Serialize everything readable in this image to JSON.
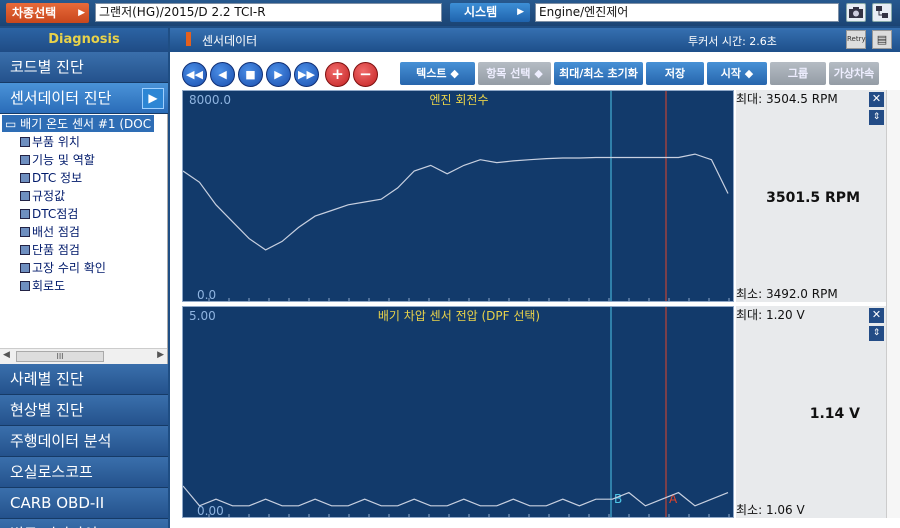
{
  "topbar": {
    "vehicle_btn": "차종선택",
    "vehicle_value": "그랜저(HG)/2015/D 2.2 TCI-R",
    "system_btn": "시스템",
    "system_value": "Engine/엔진제어"
  },
  "sidebar": {
    "header": "Diagnosis",
    "menu_top": [
      {
        "label": "코드별 진단"
      },
      {
        "label": "센서데이터 진단"
      }
    ],
    "tree_root": "배기 온도 센서 #1 (DOC",
    "tree_items": [
      "부품 위치",
      "기능 및 역할",
      "DTC 정보",
      "규정값",
      "DTC점검",
      "배선 점검",
      "단품 점검",
      "고장 수리 확인",
      "회로도"
    ],
    "scroll_thumb": "III",
    "menu_bottom": [
      {
        "label": "사례별 진단"
      },
      {
        "label": "현상별 진단"
      },
      {
        "label": "주행데이터 분석"
      },
      {
        "label": "오실로스코프"
      },
      {
        "label": "CARB OBD-II"
      },
      {
        "label": "법규 진단가이드"
      }
    ]
  },
  "main": {
    "title": "센서데이터",
    "cursor_time": "투커서 시간: 2.6초",
    "retry_label": "Retry",
    "toolbar": {
      "text_btn": "텍스트 ◆",
      "item_select": "항목 선택 ◆",
      "reset_minmax": "최대/최소 초기화",
      "save": "저장",
      "start": "시작 ◆",
      "group": "그룹",
      "virtual": "가상차속"
    }
  },
  "panels": [
    {
      "name": "엔진 회전수",
      "ymax": "8000.0",
      "ymin": "0.0",
      "max_label": "최대: 3504.5 RPM",
      "min_label": "최소: 3492.0 RPM",
      "current": "3501.5 RPM",
      "color": "#c8d0e0"
    },
    {
      "name": "배기 차압 센서 전압 (DPF 선택)",
      "ymax": "5.00",
      "ymin": "0.00",
      "max_label": "최대:  1.20 V",
      "min_label": "최소:  1.06 V",
      "current": "1.14 V",
      "cursor_b": "B",
      "cursor_a": "A",
      "color": "#c8d0e0"
    }
  ],
  "colors": {
    "chart_bg": "#123a6b",
    "cursor_b": "#4fc7e8",
    "cursor_a": "#e0442a",
    "label_yellow": "#e8d24a",
    "accent_orange": "#d9542a"
  },
  "chart_data": [
    {
      "type": "line",
      "title": "엔진 회전수",
      "ylim": [
        0,
        8000
      ],
      "series": [
        {
          "name": "엔진 회전수",
          "values": [
            3460,
            3440,
            3400,
            3370,
            3340,
            3320,
            3335,
            3360,
            3380,
            3390,
            3400,
            3405,
            3410,
            3430,
            3460,
            3470,
            3455,
            3470,
            3480,
            3475,
            3478,
            3480,
            3482,
            3483,
            3483,
            3484,
            3484,
            3484,
            3484,
            3484,
            3484,
            3490,
            3480,
            3420
          ]
        }
      ]
    },
    {
      "type": "line",
      "title": "배기 차압 센서 전압 (DPF 선택)",
      "ylim": [
        0,
        5
      ],
      "series": [
        {
          "name": "배기 차압 센서 전압 (DPF 선택)",
          "values": [
            1.15,
            1.12,
            1.13,
            1.12,
            1.12,
            1.13,
            1.12,
            1.12,
            1.13,
            1.12,
            1.12,
            1.13,
            1.12,
            1.12,
            1.13,
            1.12,
            1.12,
            1.13,
            1.12,
            1.12,
            1.13,
            1.12,
            1.12,
            1.13,
            1.12,
            1.13,
            1.13,
            1.14,
            1.12,
            1.13,
            1.14,
            1.12,
            1.13,
            1.14
          ]
        }
      ]
    }
  ]
}
